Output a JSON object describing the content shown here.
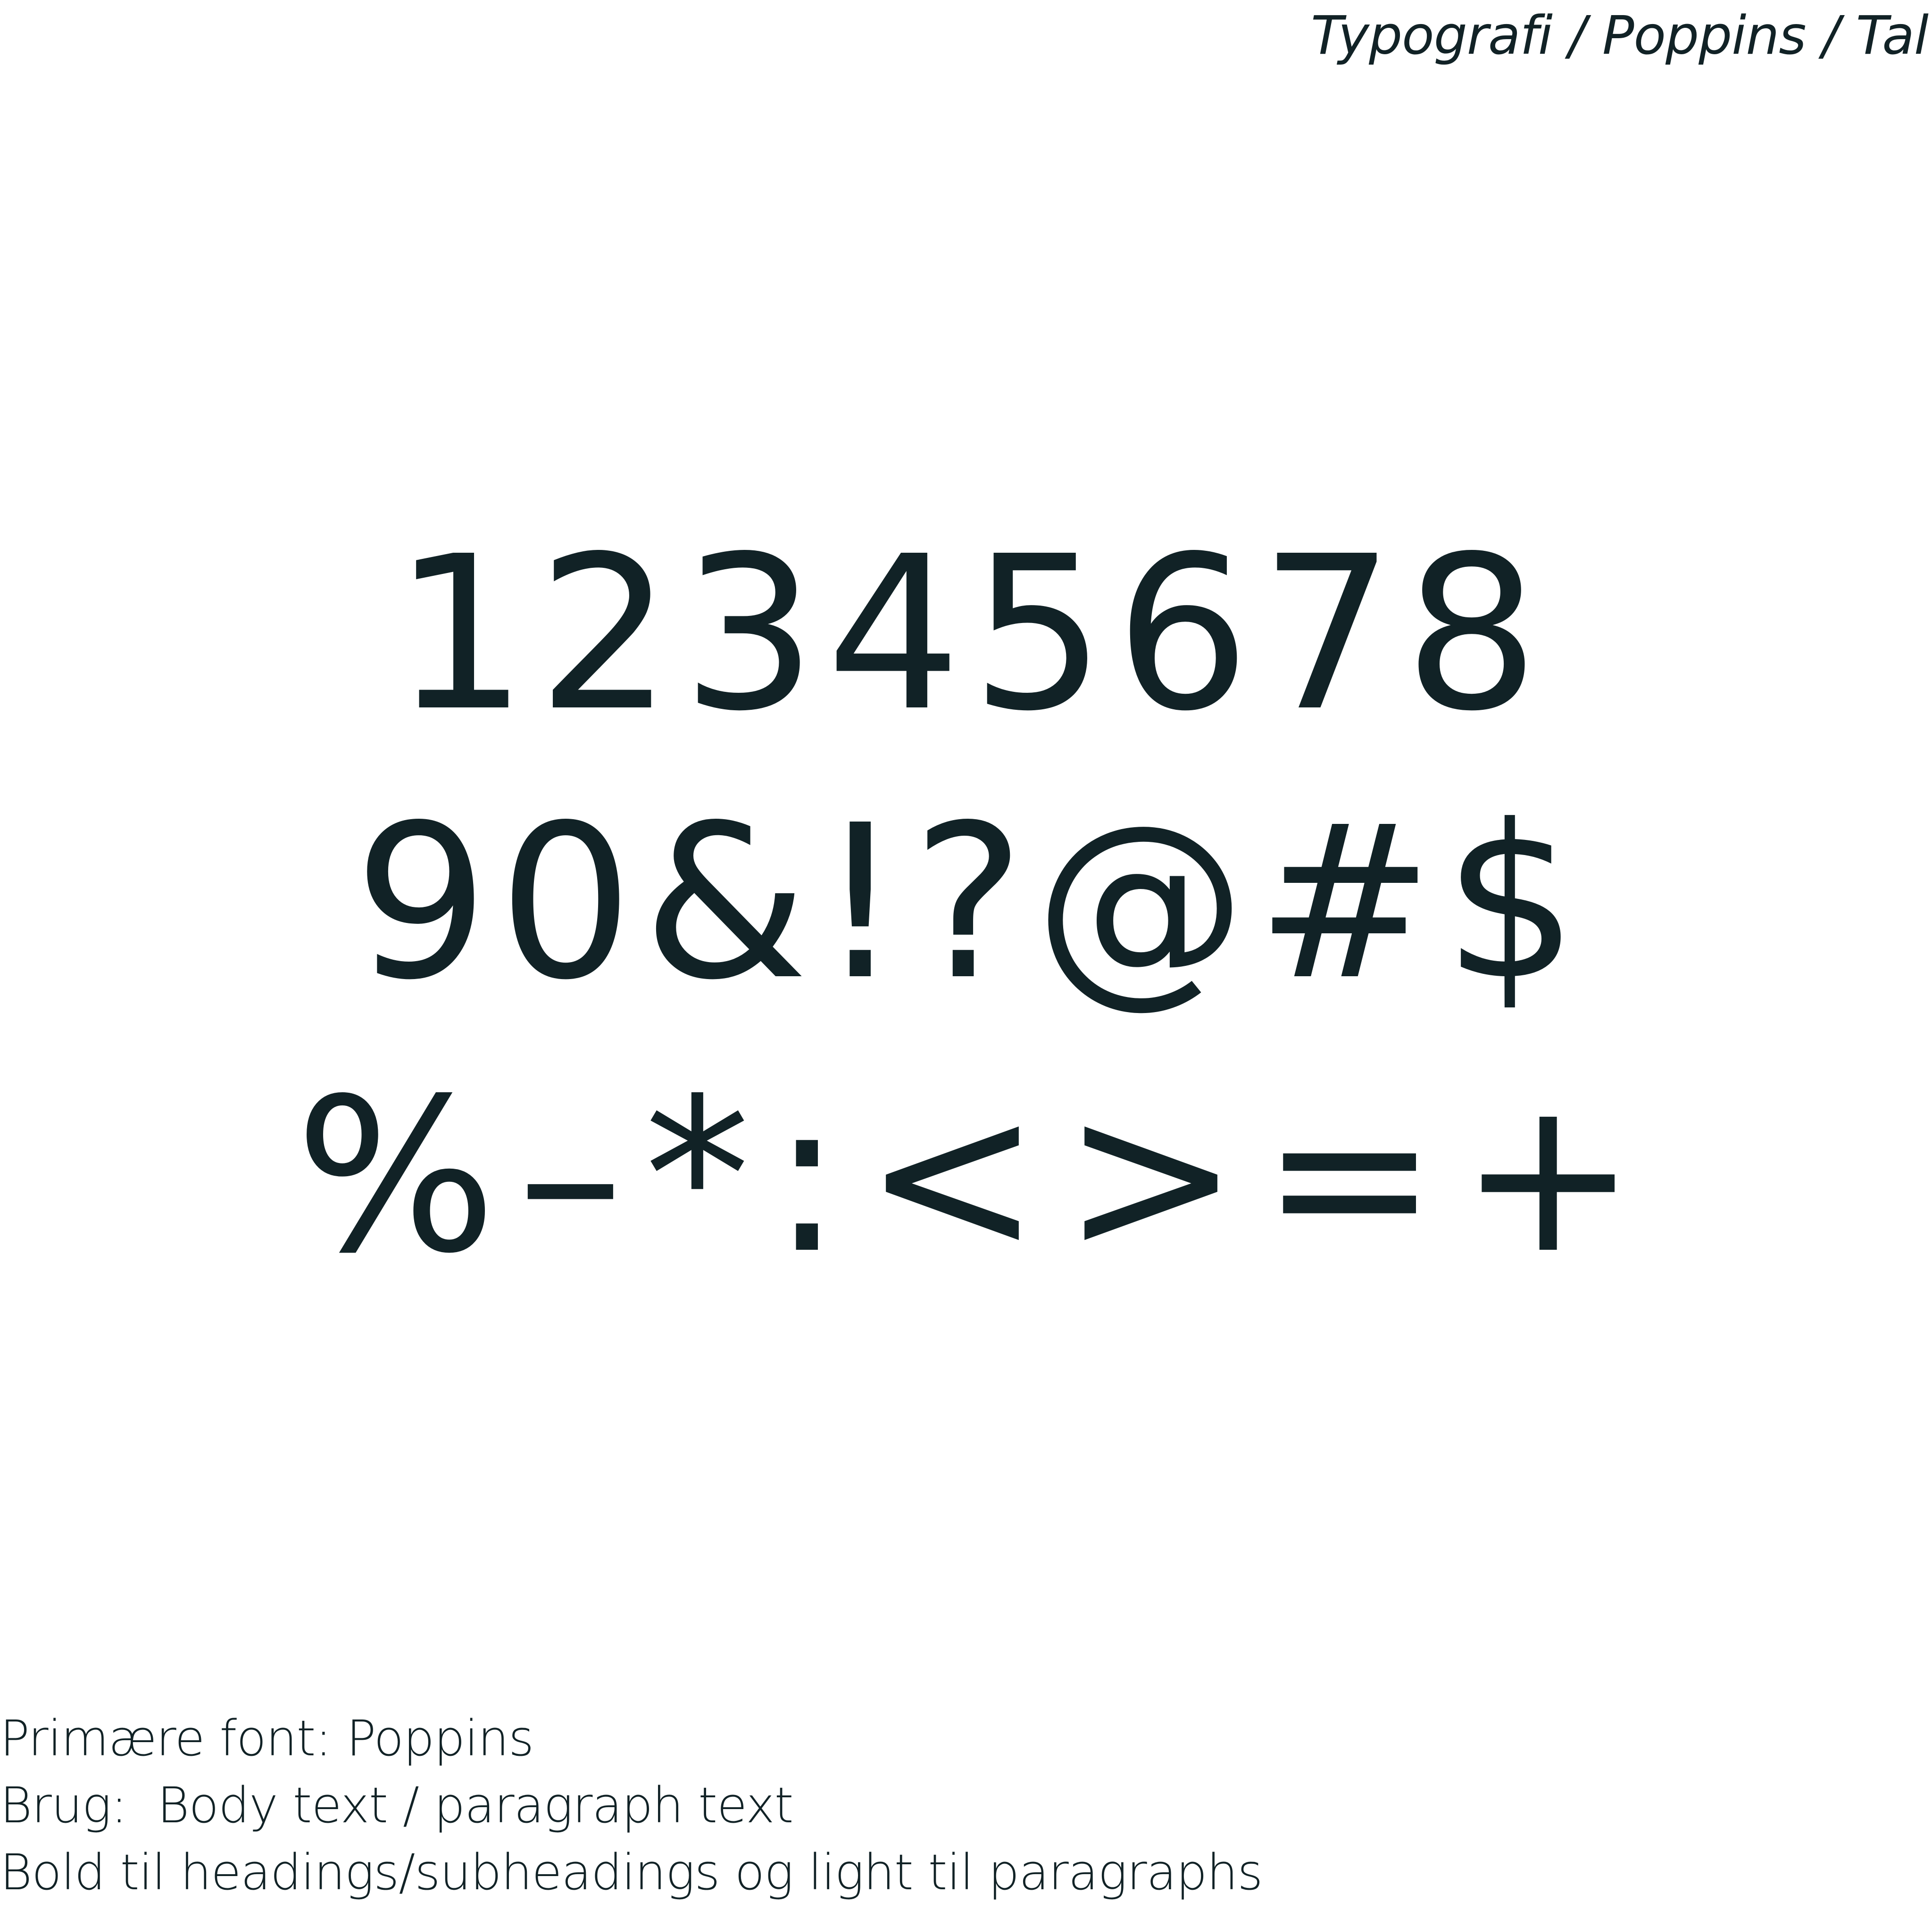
{
  "header": {
    "title": "Typografi / Poppins / Tal"
  },
  "glyph_rows": [
    [
      "1",
      "2",
      "3",
      "4",
      "5",
      "6",
      "7",
      "8"
    ],
    [
      "9",
      "0",
      "&",
      "!",
      "?",
      "@",
      "#",
      "$"
    ],
    [
      "%",
      "–",
      "*",
      ":",
      "<",
      ">",
      "=",
      "+"
    ]
  ],
  "notes": {
    "line1": "Primære font: Poppins",
    "line2": "Brug:  Body text / paragraph text",
    "line3": "Bold til headings/subheadings og light til paragraphs"
  },
  "colors": {
    "text": "#112226",
    "background": "#ffffff"
  }
}
